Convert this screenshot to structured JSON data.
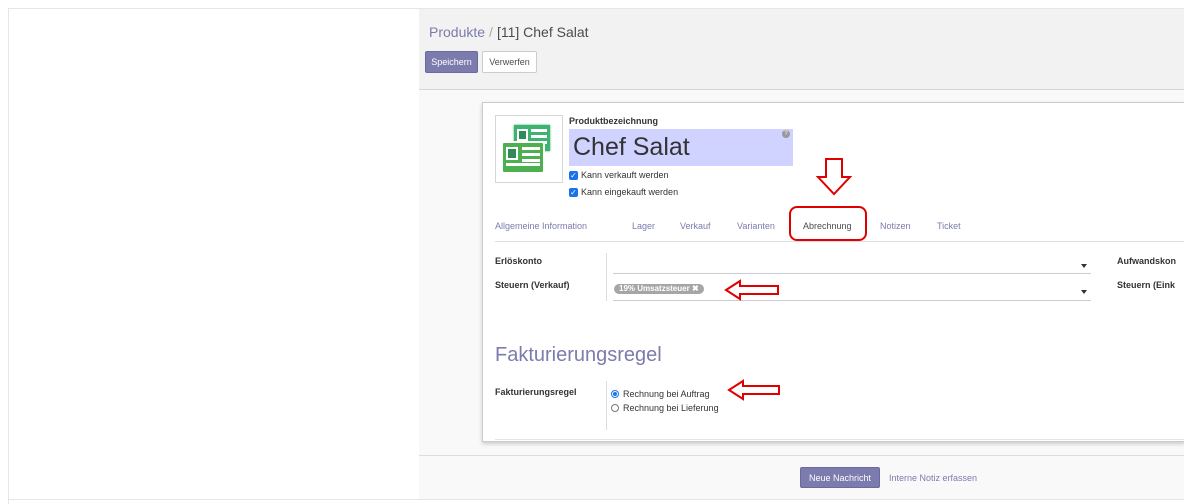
{
  "breadcrumb": {
    "root": "Produkte",
    "separator": "/",
    "current": "[11] Chef Salat"
  },
  "buttons": {
    "save": "Speichern",
    "discard": "Verwerfen"
  },
  "product": {
    "name_label": "Produktbezeichnung",
    "name_value": "Chef Salat",
    "can_be_sold": {
      "label": "Kann verkauft werden",
      "checked": true
    },
    "can_be_purchased": {
      "label": "Kann eingekauft werden",
      "checked": true
    }
  },
  "tabs": [
    {
      "label": "Allgemeine Information",
      "active": false
    },
    {
      "label": "Lager",
      "active": false
    },
    {
      "label": "Verkauf",
      "active": false
    },
    {
      "label": "Varianten",
      "active": false
    },
    {
      "label": "Abrechnung",
      "active": true
    },
    {
      "label": "Notizen",
      "active": false
    },
    {
      "label": "Ticket",
      "active": false
    }
  ],
  "accounting": {
    "income_account_label": "Erlöskonto",
    "income_account_value": "",
    "expense_account_label": "Aufwandskon",
    "sales_taxes_label": "Steuern (Verkauf)",
    "sales_tax_tag": "19% Umsatzsteuer",
    "purchase_taxes_label": "Steuern (Eink"
  },
  "invoicing": {
    "section_title": "Fakturierungsregel",
    "field_label": "Fakturierungsregel",
    "options": [
      {
        "label": "Rechnung bei Auftrag",
        "selected": true
      },
      {
        "label": "Rechnung bei Lieferung",
        "selected": false
      }
    ]
  },
  "chatter": {
    "new_message": "Neue Nachricht",
    "log_note": "Interne Notiz erfassen"
  },
  "colors": {
    "accent": "#7c7bad",
    "annotation": "#e00000",
    "checkbox": "#1a73e8",
    "name_field_bg": "#d0d2ff"
  }
}
